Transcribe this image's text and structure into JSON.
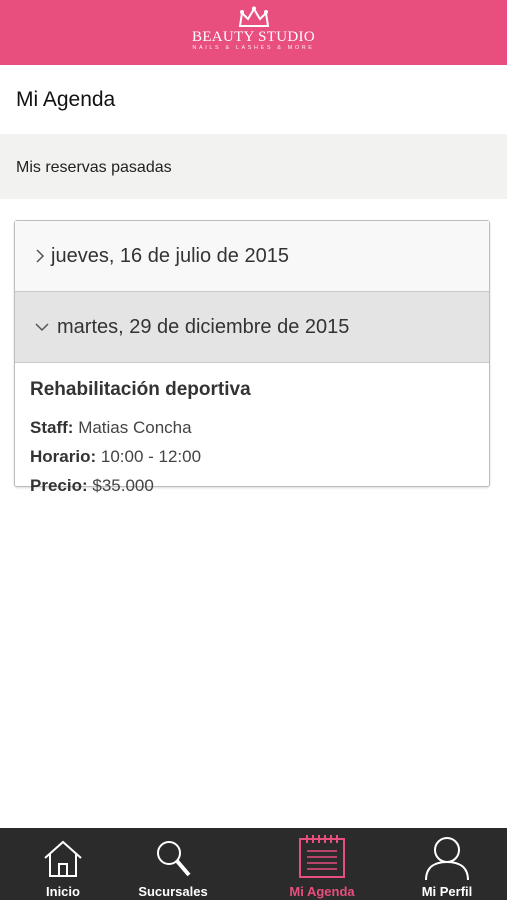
{
  "brand": {
    "name": "BEAUTY STUDIO",
    "tagline": "NAILS & LASHES & MORE",
    "color": "#e84e7e"
  },
  "page": {
    "title": "Mi Agenda",
    "section_label": "Mis reservas pasadas"
  },
  "reservations": [
    {
      "date": "jueves, 16 de julio de 2015",
      "expanded": false
    },
    {
      "date": "martes, 29 de diciembre de 2015",
      "expanded": true,
      "service": "Rehabilitación deportiva",
      "staff_label": "Staff:",
      "staff": "Matias Concha",
      "time_label": "Horario:",
      "time": "10:00 - 12:00",
      "price_label": "Precio:",
      "price": "$35.000"
    }
  ],
  "tabs": [
    {
      "label": "Inicio",
      "icon": "home-icon"
    },
    {
      "label": "Sucursales",
      "icon": "search-icon"
    },
    {
      "label": "Mi Agenda",
      "icon": "calendar-icon",
      "active": true
    },
    {
      "label": "Mi Perfil",
      "icon": "user-icon"
    }
  ]
}
